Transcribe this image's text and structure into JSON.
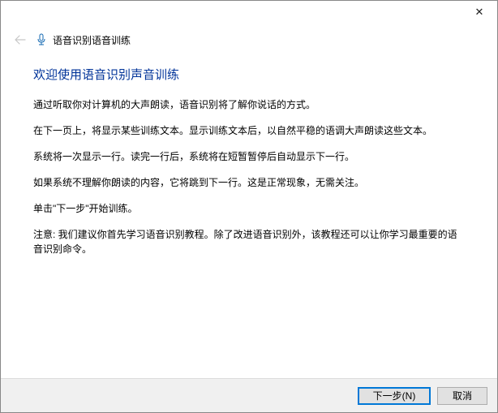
{
  "titlebar": {
    "close_label": "✕"
  },
  "header": {
    "title": "语音识别语音训练"
  },
  "main": {
    "heading": "欢迎使用语音识别声音训练",
    "p1": "通过听取你对计算机的大声朗读，语音识别将了解你说话的方式。",
    "p2": "在下一页上，将显示某些训练文本。显示训练文本后，以自然平稳的语调大声朗读这些文本。",
    "p3": "系统将一次显示一行。读完一行后，系统将在短暂暂停后自动显示下一行。",
    "p4": "如果系统不理解你朗读的内容，它将跳到下一行。这是正常现象，无需关注。",
    "p5": "单击\"下一步\"开始训练。",
    "p6": "注意: 我们建议你首先学习语音识别教程。除了改进语音识别外，该教程还可以让你学习最重要的语音识别命令。"
  },
  "footer": {
    "next_label": "下一步(N)",
    "cancel_label": "取消"
  }
}
